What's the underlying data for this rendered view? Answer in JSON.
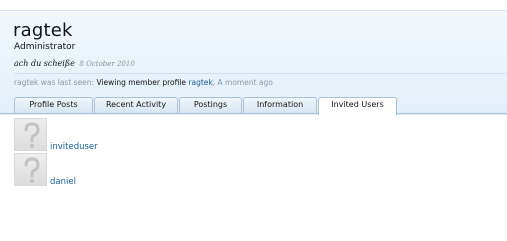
{
  "profile": {
    "username": "ragtek",
    "user_title": "Administrator",
    "status_text": "ach du scheiße",
    "status_date": "8 October 2010",
    "last_seen_label": "ragtek was last seen:",
    "last_seen_activity": "Viewing member profile",
    "last_seen_link": "ragtek",
    "last_seen_time": ", A moment ago"
  },
  "tabs": [
    {
      "label": "Profile Posts",
      "active": false
    },
    {
      "label": "Recent Activity",
      "active": false
    },
    {
      "label": "Postings",
      "active": false
    },
    {
      "label": "Information",
      "active": false
    },
    {
      "label": "Invited Users",
      "active": true
    }
  ],
  "invited_users": [
    {
      "name": "inviteduser",
      "avatar_icon": "default-avatar-question-mark-icon"
    },
    {
      "name": "daniel",
      "avatar_icon": "default-avatar-question-mark-icon"
    }
  ],
  "colors": {
    "link": "#176093",
    "muted": "#8c97a5",
    "header_bg": "#e3eff9",
    "tab_border": "#a9c2d8"
  }
}
